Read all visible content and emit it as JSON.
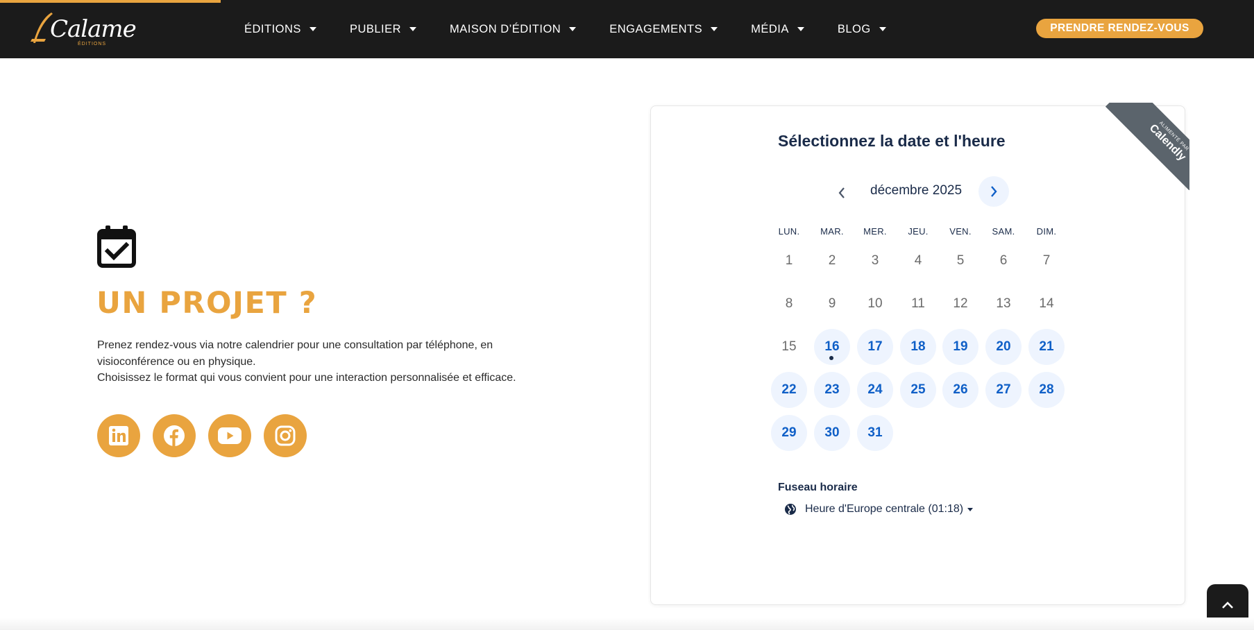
{
  "header": {
    "logo_text": "Calame",
    "logo_sub": "ÉDITIONS",
    "nav": [
      {
        "label": "ÉDITIONS",
        "icon": "chevron-down-icon"
      },
      {
        "label": "PUBLIER",
        "icon": "chevron-down-icon"
      },
      {
        "label": "MAISON D’ÉDITION",
        "icon": "chevron-down-icon"
      },
      {
        "label": "ENGAGEMENTS",
        "icon": "chevron-down-icon"
      },
      {
        "label": "MÉDIA",
        "icon": "chevron-down-icon"
      },
      {
        "label": "BLOG",
        "icon": "chevron-down-icon"
      }
    ],
    "cta_label": "PRENDRE RENDEZ-VOUS"
  },
  "main": {
    "icon": "calendar-check-icon",
    "headline": "UN PROJET ?",
    "intro_line1": "Prenez rendez-vous via notre calendrier pour une consultation par téléphone, en",
    "intro_line2": "visioconférence ou en physique.",
    "intro_line3": "Choisissez le format qui vous convient pour une interaction personnalisée et efficace.",
    "socials": [
      {
        "name": "linkedin",
        "icon": "linkedin-icon"
      },
      {
        "name": "facebook",
        "icon": "facebook-icon"
      },
      {
        "name": "youtube",
        "icon": "youtube-icon"
      },
      {
        "name": "instagram",
        "icon": "instagram-icon"
      }
    ]
  },
  "calendly": {
    "ribbon_small": "ALIMENTÉ PAR",
    "ribbon_big": "Calendly",
    "title": "Sélectionnez la date et l'heure",
    "month": "décembre 2025",
    "weekdays": [
      "LUN.",
      "MAR.",
      "MER.",
      "JEU.",
      "VEN.",
      "SAM.",
      "DIM."
    ],
    "days": [
      {
        "label": "1",
        "available": false
      },
      {
        "label": "2",
        "available": false
      },
      {
        "label": "3",
        "available": false
      },
      {
        "label": "4",
        "available": false
      },
      {
        "label": "5",
        "available": false
      },
      {
        "label": "6",
        "available": false
      },
      {
        "label": "7",
        "available": false
      },
      {
        "label": "8",
        "available": false
      },
      {
        "label": "9",
        "available": false
      },
      {
        "label": "10",
        "available": false
      },
      {
        "label": "11",
        "available": false
      },
      {
        "label": "12",
        "available": false
      },
      {
        "label": "13",
        "available": false
      },
      {
        "label": "14",
        "available": false
      },
      {
        "label": "15",
        "available": false
      },
      {
        "label": "16",
        "available": true
      },
      {
        "label": "17",
        "available": true
      },
      {
        "label": "18",
        "available": true
      },
      {
        "label": "19",
        "available": true
      },
      {
        "label": "20",
        "available": true
      },
      {
        "label": "21",
        "available": true
      },
      {
        "label": "22",
        "available": true
      },
      {
        "label": "23",
        "available": true
      },
      {
        "label": "24",
        "available": true
      },
      {
        "label": "25",
        "available": true
      },
      {
        "label": "26",
        "available": true
      },
      {
        "label": "27",
        "available": true
      },
      {
        "label": "28",
        "available": true
      },
      {
        "label": "29",
        "available": true
      },
      {
        "label": "30",
        "available": true
      },
      {
        "label": "31",
        "available": true
      }
    ],
    "timezone_label": "Fuseau horaire",
    "timezone_value": "Heure d'Europe centrale (01:18)"
  },
  "colors": {
    "accent": "#e9a43f",
    "header_bg": "#1b1b1b",
    "calendar_blue": "#0f5fc7",
    "navy": "#1a2b49"
  }
}
